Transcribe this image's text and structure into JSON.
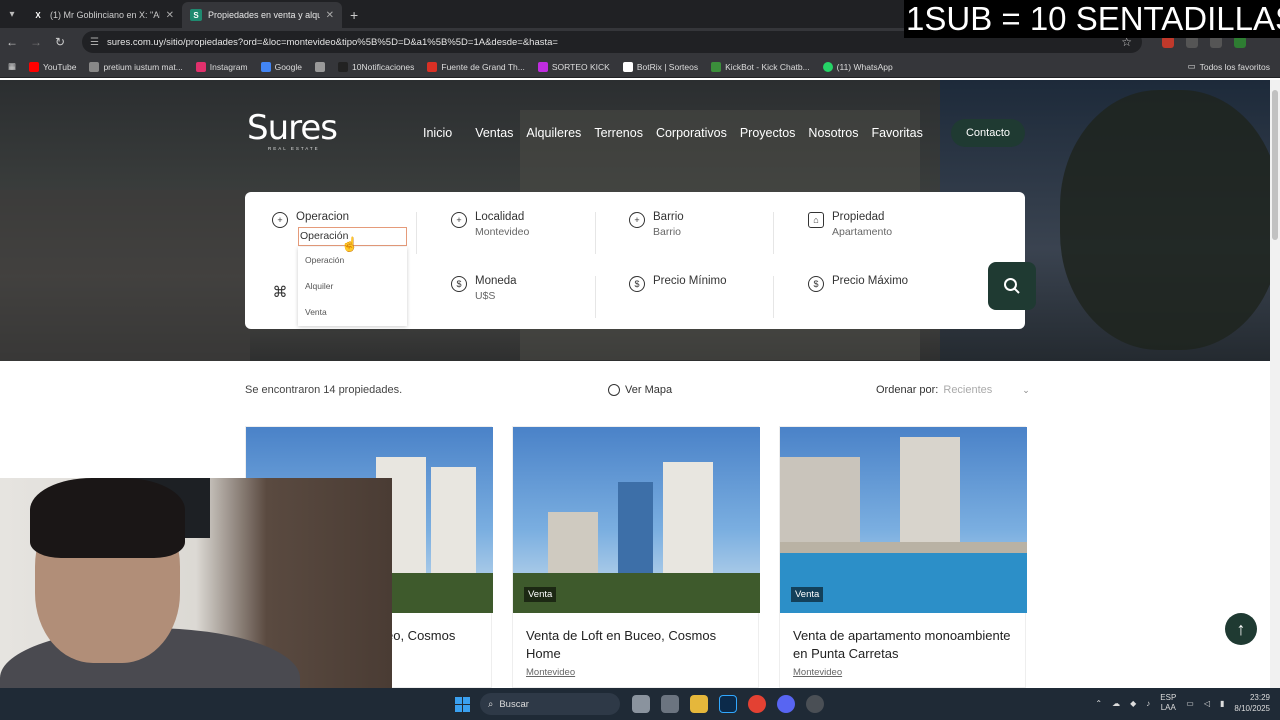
{
  "browser": {
    "tabs": [
      {
        "title": "(1) Mr Goblinciano en X: \"Ahora",
        "favicon": "X",
        "active": false
      },
      {
        "title": "Propiedades en venta y alquiler",
        "favicon": "S",
        "active": true
      }
    ],
    "new_tab": "+",
    "url": "sures.com.uy/sitio/propiedades?ord=&loc=montevideo&tipo%5B%5D=D&a1%5B%5D=1A&desde=&hasta=",
    "bookmarks": [
      "YouTube",
      "pretium iustum mat...",
      "Instagram",
      "Google",
      "",
      "10Notificaciones",
      "Fuente de Grand Th...",
      "SORTEO KICK",
      "BotRix | Sorteos",
      "KickBot - Kick Chatb...",
      "(11) WhatsApp"
    ],
    "bookmark_colors": [
      "#ff0000",
      "#888888",
      "#e1306c",
      "#4285f4",
      "#999999",
      "#222222",
      "#d93025",
      "#c02ce0",
      "#ffffff",
      "#3b8f3b",
      "#25d366"
    ],
    "all_favorites": "Todos los favoritos"
  },
  "stream_overlay": "1SUB = 10 SENTADILLAS",
  "site": {
    "logo": "Sures",
    "logo_sub": "REAL ESTATE",
    "nav": [
      "Inicio",
      "Ventas",
      "Alquileres",
      "Terrenos",
      "Corporativos",
      "Proyectos",
      "Nosotros",
      "Favoritas"
    ],
    "contact": "Contacto",
    "search": {
      "operacion": {
        "label": "Operacion",
        "value": "Operación"
      },
      "localidad": {
        "label": "Localidad",
        "value": "Montevideo"
      },
      "barrio": {
        "label": "Barrio",
        "value": "Barrio"
      },
      "propiedad": {
        "label": "Propiedad",
        "value": "Apartamento"
      },
      "moneda": {
        "label": "Moneda",
        "value": "U$S"
      },
      "precio_min": {
        "label": "Precio Mínimo"
      },
      "precio_max": {
        "label": "Precio Máximo"
      },
      "dropdown_options": [
        "Operación",
        "Alquiler",
        "Venta"
      ]
    },
    "results_text": "Se encontraron 14 propiedades.",
    "map_link": "Ver Mapa",
    "sort_label": "Ordenar por:",
    "sort_value": "Recientes",
    "cards": [
      {
        "badge": "",
        "title": "eo, Cosmos",
        "location": ""
      },
      {
        "badge": "Venta",
        "title": "Venta de Loft en Buceo, Cosmos Home",
        "location": "Montevideo"
      },
      {
        "badge": "Venta",
        "title": "Venta de apartamento monoambiente en Punta Carretas",
        "location": "Montevideo"
      }
    ]
  },
  "taskbar": {
    "search_placeholder": "Buscar",
    "lang": "ESP",
    "lang2": "LAA",
    "time": "23:29",
    "date": "8/10/2025"
  },
  "colors": {
    "brand_dark": "#1f3a32",
    "accent_outline": "#e59b7a"
  }
}
